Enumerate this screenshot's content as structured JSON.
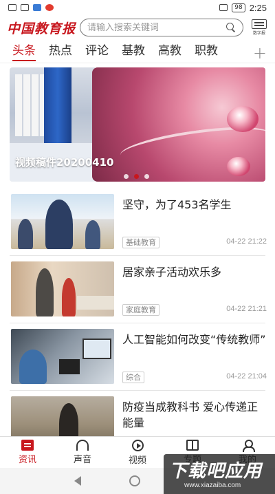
{
  "status_bar": {
    "battery": "98",
    "time": "2:25"
  },
  "header": {
    "logo": "中国教育报",
    "search_placeholder": "请输入搜索关键词",
    "paper_label": "数字报"
  },
  "tabs": [
    {
      "label": "头条",
      "active": true
    },
    {
      "label": "热点"
    },
    {
      "label": "评论"
    },
    {
      "label": "基教"
    },
    {
      "label": "高教"
    },
    {
      "label": "职教"
    }
  ],
  "tab_add": "+",
  "banner": {
    "title": "视频稿件20200410",
    "slides": 3,
    "active_slide": 2
  },
  "news": [
    {
      "title": "坚守，为了453名学生",
      "tag": "基础教育",
      "time": "04-22 21:22"
    },
    {
      "title": "居家亲子活动欢乐多",
      "tag": "家庭教育",
      "time": "04-22 21:21"
    },
    {
      "title": "人工智能如何改变“传统教师”",
      "tag": "综合",
      "time": "04-22 21:04"
    },
    {
      "title": "防疫当成教科书 爱心传递正能量"
    }
  ],
  "bottom_nav": [
    {
      "label": "资讯",
      "icon": "news-icon",
      "active": true
    },
    {
      "label": "声音",
      "icon": "headphones-icon"
    },
    {
      "label": "视频",
      "icon": "play-icon"
    },
    {
      "label": "专题",
      "icon": "book-icon"
    },
    {
      "label": "我的",
      "icon": "user-icon"
    }
  ],
  "watermark": {
    "title": "下载吧应用",
    "url": "www.xiazaiba.com"
  },
  "colors": {
    "accent": "#c8171e"
  }
}
